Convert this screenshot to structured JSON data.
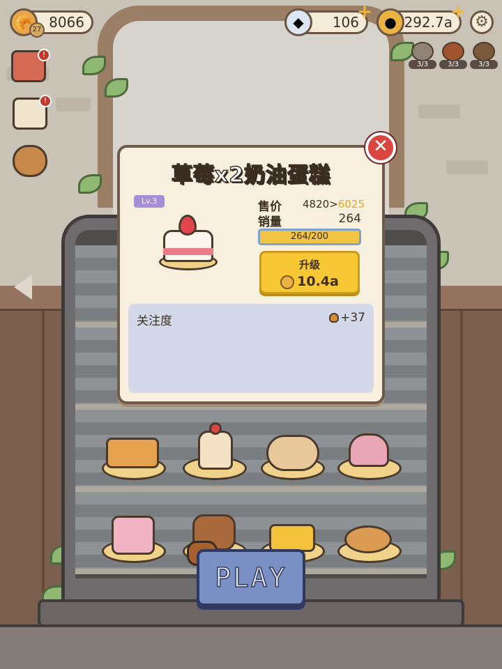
{
  "hud": {
    "bread_count": "8066",
    "player_level": "27",
    "gems": "106",
    "coins": "292.7a",
    "helpers": [
      {
        "icon": "helper-cat-icon",
        "count": "3/3"
      },
      {
        "icon": "helper-fox-icon",
        "count": "3/3"
      },
      {
        "icon": "helper-dog-icon",
        "count": "3/3"
      }
    ]
  },
  "side_menu": [
    {
      "name": "shop-icon",
      "badge": "!"
    },
    {
      "name": "task-list-icon",
      "badge": "!"
    },
    {
      "name": "gift-bag-icon",
      "badge": ""
    }
  ],
  "dialog": {
    "title": "草莓x2奶油蛋糕",
    "level": "Lv.3",
    "price_label": "售价",
    "price_current": "4820",
    "price_next": "6025",
    "sales_label": "销量",
    "sales_value": "264",
    "progress_text": "264/200",
    "progress_fraction": 1.0,
    "upgrade_label": "升级",
    "upgrade_cost": "10.4a",
    "attention_label": "关注度",
    "attention_value": "+37"
  },
  "play_label": "PLAY",
  "colors": {
    "accent_yellow": "#f7c735",
    "price_next": "#e2a92a",
    "close_red": "#d8463f",
    "play_blue": "#7a8fc3"
  }
}
